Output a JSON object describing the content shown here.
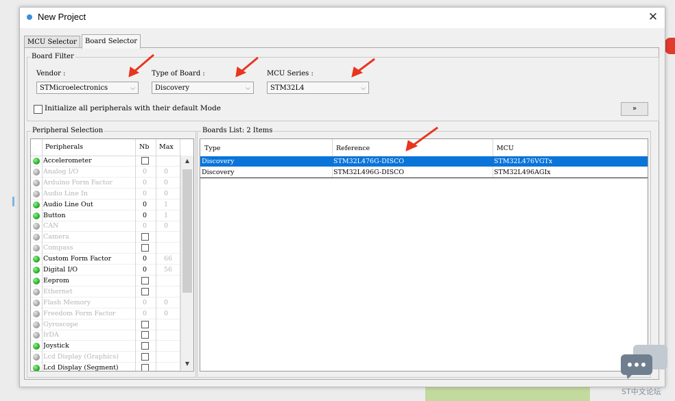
{
  "window": {
    "title": "New Project"
  },
  "tabs": [
    {
      "label": "MCU Selector",
      "active": false
    },
    {
      "label": "Board Selector",
      "active": true
    }
  ],
  "board_filter": {
    "group_label": "Board Filter",
    "vendor": {
      "label": "Vendor :",
      "value": "STMicroelectronics"
    },
    "type_of_board": {
      "label": "Type of Board :",
      "value": "Discovery"
    },
    "mcu_series": {
      "label": "MCU Series :",
      "value": "STM32L4"
    },
    "init_checkbox_label": "Initialize all peripherals with their default Mode",
    "init_checked": false,
    "expand_button": "»"
  },
  "peripheral_selection": {
    "group_label": "Peripheral Selection",
    "headers": [
      "Peripherals",
      "Nb",
      "Max"
    ],
    "rows": [
      {
        "name": "Accelerometer",
        "enabled": true,
        "nb": "",
        "max": "",
        "checkbox": true
      },
      {
        "name": "Analog I/O",
        "enabled": false,
        "nb": "0",
        "max": "0",
        "checkbox": false
      },
      {
        "name": "Arduino Form Factor",
        "enabled": false,
        "nb": "0",
        "max": "0",
        "checkbox": false
      },
      {
        "name": "Audio Line In",
        "enabled": false,
        "nb": "0",
        "max": "0",
        "checkbox": false
      },
      {
        "name": "Audio Line Out",
        "enabled": true,
        "nb": "0",
        "max": "1",
        "checkbox": false
      },
      {
        "name": "Button",
        "enabled": true,
        "nb": "0",
        "max": "1",
        "checkbox": false
      },
      {
        "name": "CAN",
        "enabled": false,
        "nb": "0",
        "max": "0",
        "checkbox": false
      },
      {
        "name": "Camera",
        "enabled": false,
        "nb": "",
        "max": "",
        "checkbox": true
      },
      {
        "name": "Compass",
        "enabled": false,
        "nb": "",
        "max": "",
        "checkbox": true
      },
      {
        "name": "Custom Form Factor",
        "enabled": true,
        "nb": "0",
        "max": "66",
        "checkbox": false
      },
      {
        "name": "Digital I/O",
        "enabled": true,
        "nb": "0",
        "max": "56",
        "checkbox": false
      },
      {
        "name": "Eeprom",
        "enabled": true,
        "nb": "",
        "max": "",
        "checkbox": true
      },
      {
        "name": "Ethernet",
        "enabled": false,
        "nb": "",
        "max": "",
        "checkbox": true
      },
      {
        "name": "Flash Memory",
        "enabled": false,
        "nb": "0",
        "max": "0",
        "checkbox": false
      },
      {
        "name": "Freedom Form Factor",
        "enabled": false,
        "nb": "0",
        "max": "0",
        "checkbox": false
      },
      {
        "name": "Gyroscope",
        "enabled": false,
        "nb": "",
        "max": "",
        "checkbox": true
      },
      {
        "name": "IrDA",
        "enabled": false,
        "nb": "",
        "max": "",
        "checkbox": true
      },
      {
        "name": "Joystick",
        "enabled": true,
        "nb": "",
        "max": "",
        "checkbox": true
      },
      {
        "name": "Lcd Display (Graphics)",
        "enabled": false,
        "nb": "",
        "max": "",
        "checkbox": true
      },
      {
        "name": "Lcd Display (Segment)",
        "enabled": true,
        "nb": "",
        "max": "",
        "checkbox": true
      }
    ]
  },
  "boards_list": {
    "group_label": "Boards List: 2 Items",
    "headers": [
      "Type",
      "Reference",
      "MCU"
    ],
    "rows": [
      {
        "type": "Discovery",
        "reference": "STM32L476G-DISCO",
        "mcu": "STM32L476VGTx",
        "selected": true
      },
      {
        "type": "Discovery",
        "reference": "STM32L496G-DISCO",
        "mcu": "STM32L496AGIx",
        "selected": false
      }
    ]
  },
  "watermark": {
    "text": "ST中文论坛",
    "icon": "chat-bubble-icon"
  },
  "colors": {
    "selection": "#0a74d8",
    "arrow": "#e8351f",
    "enabled_dot": "#1aa31a"
  }
}
